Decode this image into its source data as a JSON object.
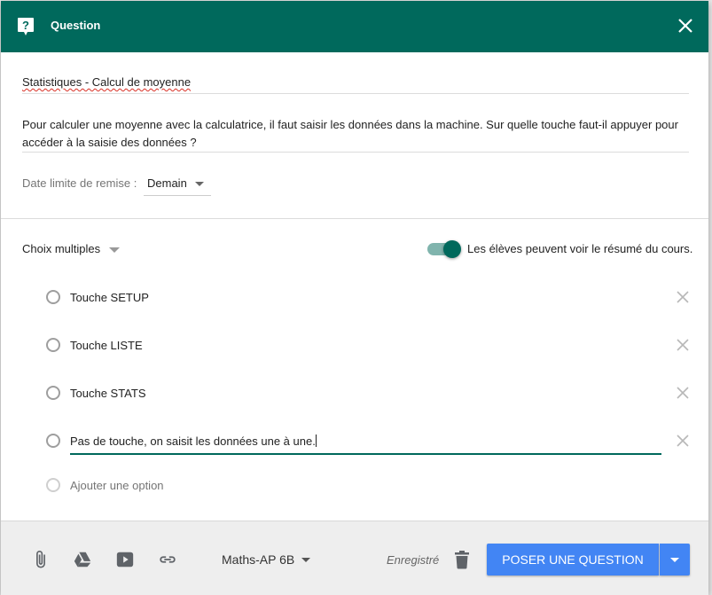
{
  "header": {
    "title": "Question",
    "icon": "question-icon",
    "close_icon": "close-icon",
    "bg_color": "#00695c"
  },
  "form": {
    "title": "Statistiques - Calcul de moyenne",
    "description": "Pour calculer une moyenne avec la calculatrice, il faut saisir les données dans la machine. Sur quelle touche faut-il appuyer pour accéder à la saisie des données ?",
    "due_label": "Date limite de remise :",
    "due_value": "Demain"
  },
  "question_type": "Choix multiples",
  "summary_toggle": {
    "label": "Les élèves peuvent voir le résumé du cours.",
    "on": true
  },
  "options": [
    {
      "label": "Touche SETUP"
    },
    {
      "label": "Touche LISTE"
    },
    {
      "label": "Touche STATS"
    },
    {
      "label": "Pas de touche, on saisit les données une à une."
    }
  ],
  "add_option_label": "Ajouter une option",
  "footer": {
    "icons": [
      "paperclip-icon",
      "drive-icon",
      "youtube-icon",
      "link-icon"
    ],
    "class_name": "Maths-AP 6B",
    "saved_label": "Enregistré",
    "submit_label": "POSER UNE QUESTION",
    "accent_color": "#4285f4"
  }
}
